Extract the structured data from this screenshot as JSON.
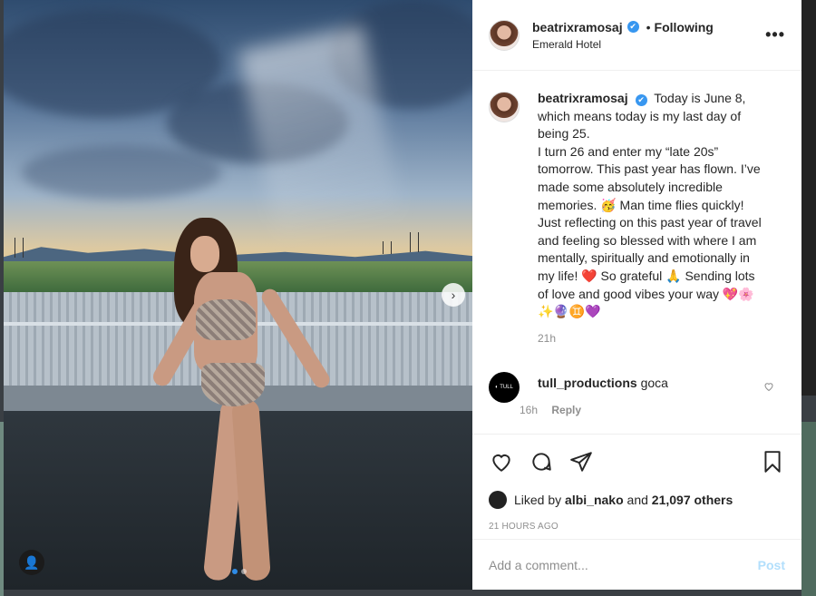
{
  "post": {
    "username": "beatrixramosaj",
    "verified_mark": "✔",
    "separator": "•",
    "following_label": "Following",
    "location": "Emerald Hotel",
    "more_label": "•••",
    "caption_lines": [
      "Today is June 8,",
      "which means today is my last day of being 25.",
      "I turn 26 and enter my “late 20s” tomorrow. This past year has flown. I’ve made some absolutely incredible memories. 🥳 Man time flies quickly! Just reflecting on this past year of travel and feeling so blessed with where I am mentally, spiritually and emotionally in my life! ❤️ So grateful 🙏 Sending lots of love and good vibes your way 💖🌸✨🔮♊💜"
    ],
    "caption_time": "21h",
    "comment": {
      "username": "tull_productions",
      "avatar_text": "◐ TULL",
      "text": "goca",
      "time": "16h",
      "reply_label": "Reply"
    },
    "liked_by_prefix": "Liked by",
    "liked_by_user": "albi_nako",
    "liked_by_suffix": "and",
    "likes_count": "21,097 others",
    "posted_ago": "21 HOURS AGO",
    "comment_placeholder": "Add a comment...",
    "post_button": "Post",
    "next_arrow": "›",
    "tag_icon": "👤"
  },
  "icons": [
    "heart-icon",
    "comment-icon",
    "share-icon",
    "bookmark-icon",
    "more-icon",
    "chevron-right-icon",
    "user-tag-icon",
    "verified-icon"
  ],
  "colors": {
    "verified": "#3897f0",
    "post_button": "#b2dffc",
    "carousel_active": "#2e8be6",
    "text": "#262626",
    "muted": "#8e8e8e"
  }
}
